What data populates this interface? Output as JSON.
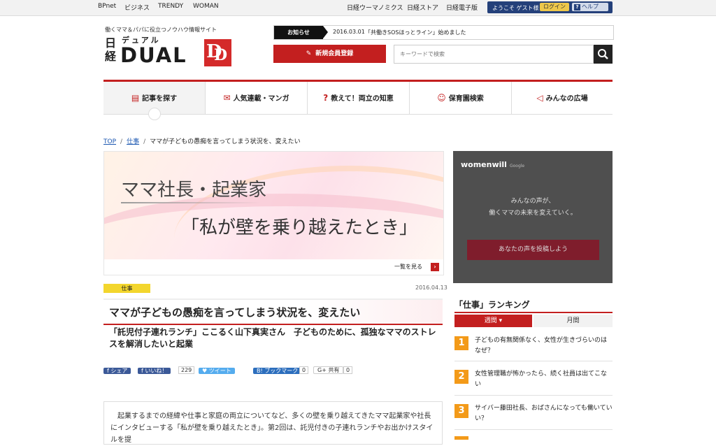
{
  "topbar": {
    "left_links": [
      "BPnet",
      "ビジネス",
      "TRENDY",
      "WOMAN"
    ],
    "right_links": [
      "日経ウーマノミクス",
      "日経ストア",
      "日経電子版"
    ],
    "welcome": "ようこそ ゲスト様",
    "login": "ログイン",
    "help": "ヘルプ"
  },
  "brand": {
    "tagline": "働くママ＆パパに役立つノウハウ情報サイト",
    "logo_jp": "日経",
    "logo_kana": "デュアル",
    "logo_word": "DUAL",
    "logo_mark": "DD"
  },
  "notice": {
    "label": "お知らせ",
    "date": "2016.03.01",
    "text": "「共働きSOSほっとライン」始めました"
  },
  "register_label": "新規会員登録",
  "search": {
    "placeholder": "キーワードで検索"
  },
  "nav": {
    "items": [
      {
        "label": "記事を探す",
        "icon": "document-icon"
      },
      {
        "label": "人気連載・マンガ",
        "icon": "book-icon"
      },
      {
        "label": "教えて！両立の知恵",
        "icon": "question-icon"
      },
      {
        "label": "保育園検索",
        "icon": "baby-face-icon"
      },
      {
        "label": "みんなの広場",
        "icon": "megaphone-icon"
      }
    ]
  },
  "breadcrumb": {
    "top": "TOP",
    "category": "仕事",
    "current": "ママが子どもの愚痴を言ってしまう状況を、変えたい"
  },
  "banner": {
    "line1": "ママ社長・起業家",
    "line2": "「私が壁を乗り越えたとき」",
    "more": "一覧を見る"
  },
  "article": {
    "category": "仕事",
    "date": "2016.04.13",
    "title": "ママが子どもの愚痴を言ってしまう状況を、変えたい",
    "subtitle": "「託児付子連れランチ」ここるく山下真実さん　子どものために、孤独なママのストレスを解消したいと起業",
    "lead": "起業するまでの経緯や仕事と家庭の両立についてなど、多くの壁を乗り越えてきたママ起業家や社長にインタビューする「私が壁を乗り越えたとき」。第2回は、託児付きの子連れランチやお出かけスタイルを提"
  },
  "social": {
    "share": "シェア",
    "like": "いいね！",
    "like_count": "229",
    "tweet": "ツイート",
    "hatena": "ブックマーク",
    "hatena_count": "0",
    "gplus": "共有",
    "gplus_count": "0"
  },
  "ad": {
    "brand": "womenwill",
    "brand_sub": "Google",
    "message_line1": "みんなの声が、",
    "message_line2": "働くママの未来を変えていく。",
    "cta": "あなたの声を投稿しよう"
  },
  "ranking": {
    "title": "「仕事」ランキング",
    "tab_weekly": "週間",
    "tab_monthly": "月間",
    "items": [
      {
        "rank": "1",
        "text": "子どもの有無関係なく、女性が生きづらいのはなぜ？"
      },
      {
        "rank": "2",
        "text": "女性管理職が怖かったら、続く社員は出てこない"
      },
      {
        "rank": "3",
        "text": "サイバー藤田社長、おばさんになっても働いていい？"
      }
    ]
  },
  "colors": {
    "accent_red": "#c31f1f",
    "rank_orange": "#f39a19",
    "category_yellow": "#f3d62d",
    "header_navy": "#24407a"
  }
}
